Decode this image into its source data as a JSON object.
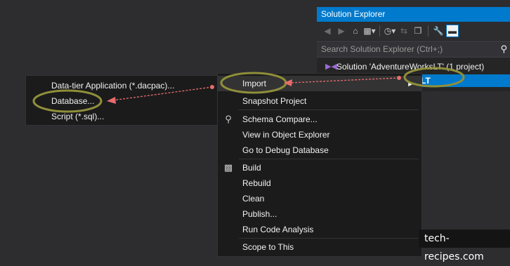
{
  "solution_explorer": {
    "title": "Solution Explorer",
    "search_placeholder": "Search Solution Explorer (Ctrl+;)",
    "solution_label": "Solution 'AdventureWorksLT' (1 project)",
    "project_label": "LT",
    "toolbar_icons": [
      "back-icon",
      "forward-icon",
      "home-icon",
      "switch-views-icon",
      "history-icon",
      "sync-icon",
      "collapse-all-icon",
      "properties-icon",
      "preview-icon"
    ]
  },
  "context_menu": {
    "items": [
      {
        "label": "Import",
        "submenu": true,
        "icon": ""
      },
      {
        "label": "Snapshot Project",
        "icon": ""
      },
      {
        "label": "Schema Compare...",
        "icon": "schema-compare-icon"
      },
      {
        "label": "View in Object Explorer",
        "icon": ""
      },
      {
        "label": "Go to Debug Database",
        "icon": ""
      },
      {
        "label": "Build",
        "icon": "build-icon"
      },
      {
        "label": "Rebuild",
        "icon": ""
      },
      {
        "label": "Clean",
        "icon": ""
      },
      {
        "label": "Publish...",
        "icon": ""
      },
      {
        "label": "Run Code Analysis",
        "icon": ""
      },
      {
        "label": "Scope to This",
        "icon": ""
      }
    ]
  },
  "import_submenu": {
    "items": [
      "Data-tier Application (*.dacpac)...",
      "Database...",
      "Script (*.sql)..."
    ]
  },
  "watermark": "tech-recipes.com",
  "colors": {
    "accent": "#007acc",
    "background": "#2d2d30",
    "menu": "#1b1b1c",
    "annotation_ellipse": "#8f8f3a",
    "annotation_arrow": "#e86c6c"
  }
}
